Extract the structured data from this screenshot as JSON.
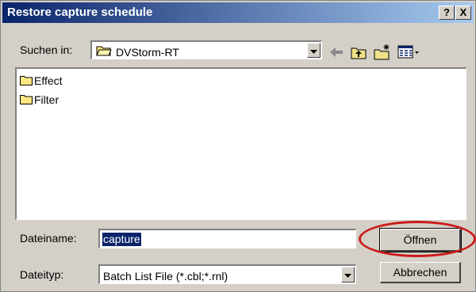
{
  "window": {
    "title": "Restore capture schedule",
    "help_glyph": "?",
    "close_glyph": "X"
  },
  "lookin": {
    "label": "Suchen in:",
    "value": "DVStorm-RT"
  },
  "toolbar": {
    "icons": [
      "back-arrow-icon",
      "up-folder-icon",
      "new-folder-icon",
      "view-menu-icon"
    ]
  },
  "files": [
    {
      "name": "Effect",
      "icon": "folder-icon"
    },
    {
      "name": "Filter",
      "icon": "folder-icon"
    }
  ],
  "filename": {
    "label": "Dateiname:",
    "value": "capture"
  },
  "filetype": {
    "label": "Dateityp:",
    "value": "Batch List File (*.cbl;*.rnl)"
  },
  "buttons": {
    "open": "Öffnen",
    "cancel": "Abbrechen"
  },
  "colors": {
    "titlebar": "#0a246a",
    "face": "#d4d0c8",
    "highlight_ring": "#cc1a1a"
  }
}
